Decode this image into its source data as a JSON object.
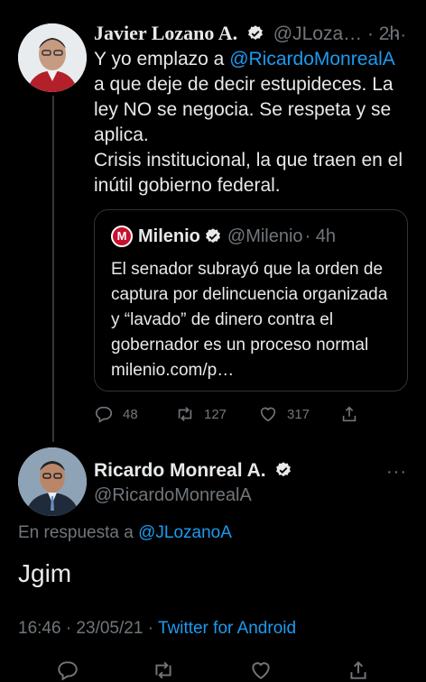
{
  "original_tweet": {
    "author_name": "Javier Lozano A.",
    "author_handle": "@JLoza…",
    "time": "· 2h",
    "text_before_mention": "Y yo emplazo a ",
    "mention": "@RicardoMonrealA",
    "text_after_mention": "\na que deje de decir estupideces. La ley NO se negocia. Se respeta y se aplica.\nCrisis institucional, la que traen en el inútil gobierno federal.",
    "quote": {
      "logo_letter": "M",
      "author_name": "Milenio",
      "author_handle": "@Milenio",
      "time": "· 4h",
      "text": "El senador subrayó que la orden de captura por delincuencia organizada y “lavado” de dinero contra el gobernador es un proceso normal milenio.com/p…"
    },
    "actions": {
      "replies": "48",
      "retweets": "127",
      "likes": "317"
    }
  },
  "reply_tweet": {
    "author_name": "Ricardo Monreal A.",
    "author_handle": "@RicardoMonrealA",
    "reply_to_label": "En respuesta a ",
    "reply_to_handle": "@JLozanoA",
    "text": "Jgim",
    "timestamp": "16:46 · 23/05/21 · ",
    "source": "Twitter for Android"
  },
  "more_glyph": "···",
  "colors": {
    "background": "#000000",
    "text": "#e7e9ea",
    "secondary": "#71767b",
    "link": "#1d9bf0",
    "verified": "#e7e9ea",
    "milenio_red": "#c8102e"
  },
  "icons": [
    "verified-badge-icon",
    "reply-icon",
    "retweet-icon",
    "like-icon",
    "share-icon",
    "more-icon"
  ]
}
